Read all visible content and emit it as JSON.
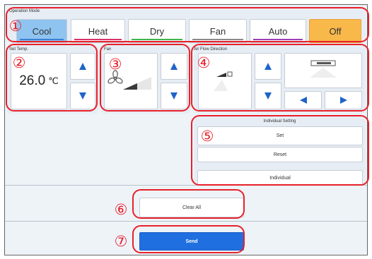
{
  "operation_mode": {
    "title": "Operation Mode",
    "modes": [
      {
        "label": "Cool",
        "underline": "#3a7fd5",
        "selected": true
      },
      {
        "label": "Heat",
        "underline": "#d6336c"
      },
      {
        "label": "Dry",
        "underline": "#3db34a"
      },
      {
        "label": "Fan",
        "underline": "#8a8a8a"
      },
      {
        "label": "Auto",
        "underline": "#9b3fb5"
      },
      {
        "label": "Off",
        "underline": "#f7a623",
        "highlight": true
      }
    ]
  },
  "set_temp": {
    "title": "Set Temp.",
    "value": "26.0",
    "unit": "℃"
  },
  "fan": {
    "title": "Fan",
    "icon": "fan-icon",
    "level": 0.5
  },
  "air_flow": {
    "title": "Air Flow Direction"
  },
  "individual": {
    "title": "Individual Setting",
    "buttons": [
      "Set",
      "Reset",
      "Individual"
    ]
  },
  "clear_all": "Clear All",
  "send": "Send",
  "callout_numbers": [
    "①",
    "②",
    "③",
    "④",
    "⑤",
    "⑥",
    "⑦"
  ],
  "colors": {
    "selected_bg": "#8fc4f0",
    "off_bg": "#f8b84a",
    "send_bg": "#1f6fe0",
    "callout": "#e8202a",
    "arrow": "#1e64c8"
  }
}
